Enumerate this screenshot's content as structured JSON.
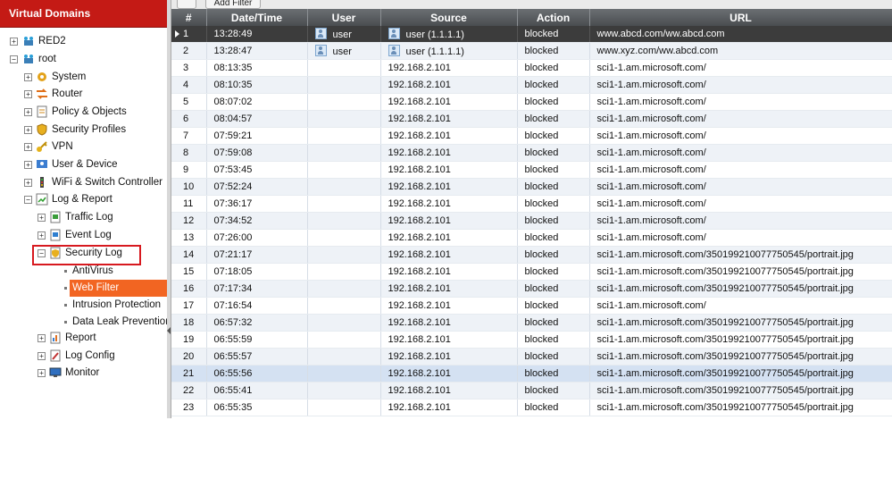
{
  "sidebar": {
    "title": "Virtual Domains",
    "items": [
      {
        "label": "RED2",
        "icon": "vdom-icon"
      },
      {
        "label": "root",
        "icon": "vdom-icon"
      },
      {
        "label": "System",
        "icon": "system-icon"
      },
      {
        "label": "Router",
        "icon": "router-icon"
      },
      {
        "label": "Policy & Objects",
        "icon": "policy-icon"
      },
      {
        "label": "Security Profiles",
        "icon": "security-profiles-icon"
      },
      {
        "label": "VPN",
        "icon": "vpn-key-icon"
      },
      {
        "label": "User & Device",
        "icon": "user-device-icon"
      },
      {
        "label": "WiFi & Switch Controller",
        "icon": "wifi-switch-icon"
      },
      {
        "label": "Log & Report",
        "icon": "log-report-icon"
      },
      {
        "label": "Traffic Log",
        "icon": "traffic-log-icon"
      },
      {
        "label": "Event Log",
        "icon": "event-log-icon"
      },
      {
        "label": "Security Log",
        "icon": "security-log-icon"
      },
      {
        "label": "AntiVirus",
        "icon": "leaf-dot"
      },
      {
        "label": "Web Filter",
        "icon": "leaf-dot"
      },
      {
        "label": "Intrusion Protection",
        "icon": "leaf-dot"
      },
      {
        "label": "Data Leak Prevention",
        "icon": "leaf-dot"
      },
      {
        "label": "Report",
        "icon": "report-icon"
      },
      {
        "label": "Log Config",
        "icon": "log-config-icon"
      },
      {
        "label": "Monitor",
        "icon": "monitor-icon"
      }
    ]
  },
  "toolbar": {
    "add_filter_label": "Add Filter"
  },
  "table": {
    "columns": [
      "#",
      "Date/Time",
      "User",
      "Source",
      "Action",
      "URL"
    ],
    "rows": [
      {
        "n": "1",
        "time": "13:28:49",
        "user": "user",
        "source": "user (1.1.1.1)",
        "action": "blocked",
        "url": "www.abcd.com/ww.abcd.com"
      },
      {
        "n": "2",
        "time": "13:28:47",
        "user": "user",
        "source": "user (1.1.1.1)",
        "action": "blocked",
        "url": "www.xyz.com/ww.abcd.com"
      },
      {
        "n": "3",
        "time": "08:13:35",
        "user": "",
        "source": "192.168.2.101",
        "action": "blocked",
        "url": "sci1-1.am.microsoft.com/"
      },
      {
        "n": "4",
        "time": "08:10:35",
        "user": "",
        "source": "192.168.2.101",
        "action": "blocked",
        "url": "sci1-1.am.microsoft.com/"
      },
      {
        "n": "5",
        "time": "08:07:02",
        "user": "",
        "source": "192.168.2.101",
        "action": "blocked",
        "url": "sci1-1.am.microsoft.com/"
      },
      {
        "n": "6",
        "time": "08:04:57",
        "user": "",
        "source": "192.168.2.101",
        "action": "blocked",
        "url": "sci1-1.am.microsoft.com/"
      },
      {
        "n": "7",
        "time": "07:59:21",
        "user": "",
        "source": "192.168.2.101",
        "action": "blocked",
        "url": "sci1-1.am.microsoft.com/"
      },
      {
        "n": "8",
        "time": "07:59:08",
        "user": "",
        "source": "192.168.2.101",
        "action": "blocked",
        "url": "sci1-1.am.microsoft.com/"
      },
      {
        "n": "9",
        "time": "07:53:45",
        "user": "",
        "source": "192.168.2.101",
        "action": "blocked",
        "url": "sci1-1.am.microsoft.com/"
      },
      {
        "n": "10",
        "time": "07:52:24",
        "user": "",
        "source": "192.168.2.101",
        "action": "blocked",
        "url": "sci1-1.am.microsoft.com/"
      },
      {
        "n": "11",
        "time": "07:36:17",
        "user": "",
        "source": "192.168.2.101",
        "action": "blocked",
        "url": "sci1-1.am.microsoft.com/"
      },
      {
        "n": "12",
        "time": "07:34:52",
        "user": "",
        "source": "192.168.2.101",
        "action": "blocked",
        "url": "sci1-1.am.microsoft.com/"
      },
      {
        "n": "13",
        "time": "07:26:00",
        "user": "",
        "source": "192.168.2.101",
        "action": "blocked",
        "url": "sci1-1.am.microsoft.com/"
      },
      {
        "n": "14",
        "time": "07:21:17",
        "user": "",
        "source": "192.168.2.101",
        "action": "blocked",
        "url": "sci1-1.am.microsoft.com/350199210077750545/portrait.jpg"
      },
      {
        "n": "15",
        "time": "07:18:05",
        "user": "",
        "source": "192.168.2.101",
        "action": "blocked",
        "url": "sci1-1.am.microsoft.com/350199210077750545/portrait.jpg"
      },
      {
        "n": "16",
        "time": "07:17:34",
        "user": "",
        "source": "192.168.2.101",
        "action": "blocked",
        "url": "sci1-1.am.microsoft.com/350199210077750545/portrait.jpg"
      },
      {
        "n": "17",
        "time": "07:16:54",
        "user": "",
        "source": "192.168.2.101",
        "action": "blocked",
        "url": "sci1-1.am.microsoft.com/"
      },
      {
        "n": "18",
        "time": "06:57:32",
        "user": "",
        "source": "192.168.2.101",
        "action": "blocked",
        "url": "sci1-1.am.microsoft.com/350199210077750545/portrait.jpg"
      },
      {
        "n": "19",
        "time": "06:55:59",
        "user": "",
        "source": "192.168.2.101",
        "action": "blocked",
        "url": "sci1-1.am.microsoft.com/350199210077750545/portrait.jpg"
      },
      {
        "n": "20",
        "time": "06:55:57",
        "user": "",
        "source": "192.168.2.101",
        "action": "blocked",
        "url": "sci1-1.am.microsoft.com/350199210077750545/portrait.jpg"
      },
      {
        "n": "21",
        "time": "06:55:56",
        "user": "",
        "source": "192.168.2.101",
        "action": "blocked",
        "url": "sci1-1.am.microsoft.com/350199210077750545/portrait.jpg"
      },
      {
        "n": "22",
        "time": "06:55:41",
        "user": "",
        "source": "192.168.2.101",
        "action": "blocked",
        "url": "sci1-1.am.microsoft.com/350199210077750545/portrait.jpg"
      },
      {
        "n": "23",
        "time": "06:55:35",
        "user": "",
        "source": "192.168.2.101",
        "action": "blocked",
        "url": "sci1-1.am.microsoft.com/350199210077750545/portrait.jpg"
      }
    ]
  },
  "colors": {
    "header_red": "#c41a15",
    "selected_orange": "#f26522",
    "highlight_box": "#d7191f",
    "table_header": "#5a5e62"
  }
}
